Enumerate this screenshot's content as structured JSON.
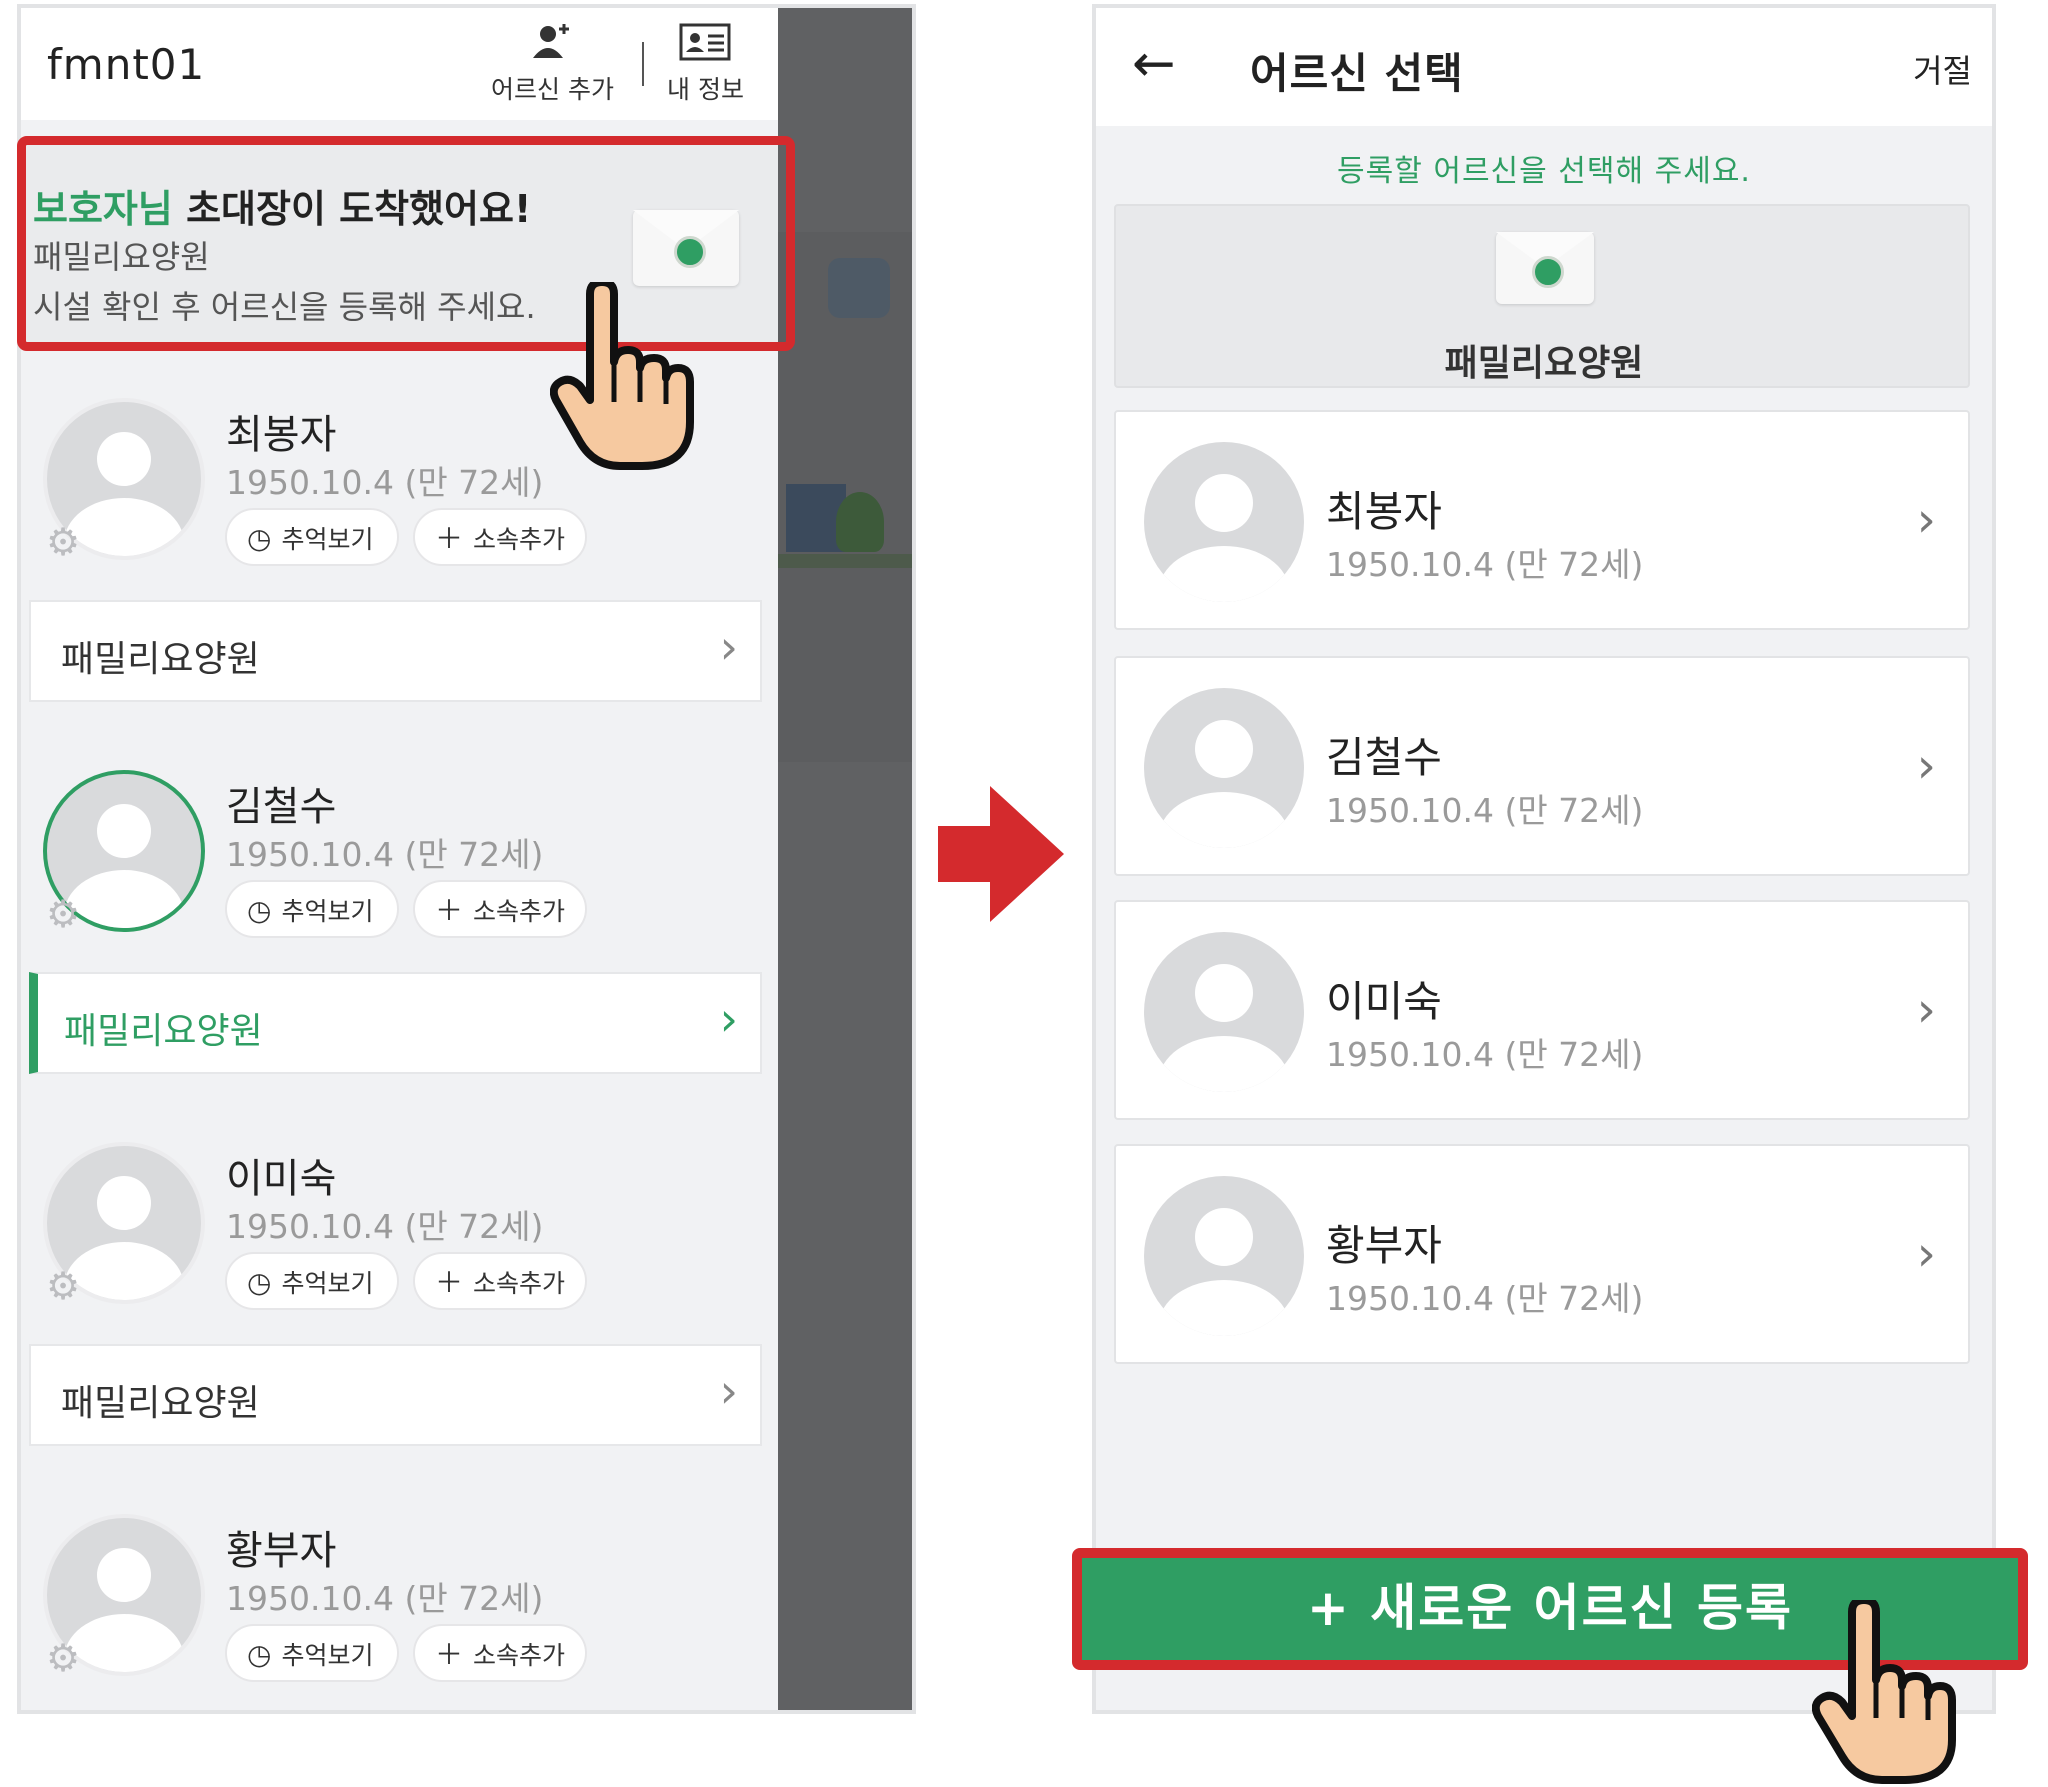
{
  "left": {
    "app_title": "fmnt01",
    "header": {
      "add_senior_label": "어르신 추가",
      "my_info_label": "내 정보"
    },
    "notice": {
      "title_highlight": "보호자님",
      "title_rest": " 초대장이 도착했어요!",
      "facility": "패밀리요양원",
      "message": "시설 확인 후 어르신을 등록해 주세요."
    },
    "seniors": [
      {
        "name": "최봉자",
        "birth": "1950.10.4 (만 72세)",
        "memories_label": "추억보기",
        "add_affiliation_label": "소속추가",
        "facility": "패밀리요양원",
        "selected": false
      },
      {
        "name": "김철수",
        "birth": "1950.10.4 (만 72세)",
        "memories_label": "추억보기",
        "add_affiliation_label": "소속추가",
        "facility": "패밀리요양원",
        "selected": true
      },
      {
        "name": "이미숙",
        "birth": "1950.10.4 (만 72세)",
        "memories_label": "추억보기",
        "add_affiliation_label": "소속추가",
        "facility": "패밀리요양원",
        "selected": false
      },
      {
        "name": "황부자",
        "birth": "1950.10.4 (만 72세)",
        "memories_label": "추억보기",
        "add_affiliation_label": "소속추가"
      }
    ]
  },
  "right": {
    "title": "어르신 선택",
    "reject_label": "거절",
    "subtitle": "등록할 어르신을 선택해 주세요.",
    "facility_name": "패밀리요양원",
    "seniors": [
      {
        "name": "최봉자",
        "birth": "1950.10.4 (만 72세)"
      },
      {
        "name": "김철수",
        "birth": "1950.10.4 (만 72세)"
      },
      {
        "name": "이미숙",
        "birth": "1950.10.4 (만 72세)"
      },
      {
        "name": "황부자",
        "birth": "1950.10.4 (만 72세)"
      }
    ],
    "new_senior_button": "+ 새로운 어르신 등록"
  },
  "colors": {
    "accent_green": "#2f9e63",
    "highlight_red": "#d42a2d",
    "dim_overlay": "#606163"
  },
  "icons": [
    "add-person-icon",
    "id-card-icon",
    "envelope-icon",
    "clock-icon",
    "plus-icon",
    "gear-icon",
    "chevron-right-icon",
    "back-arrow-icon",
    "hand-pointer-icon",
    "right-arrow-icon"
  ]
}
